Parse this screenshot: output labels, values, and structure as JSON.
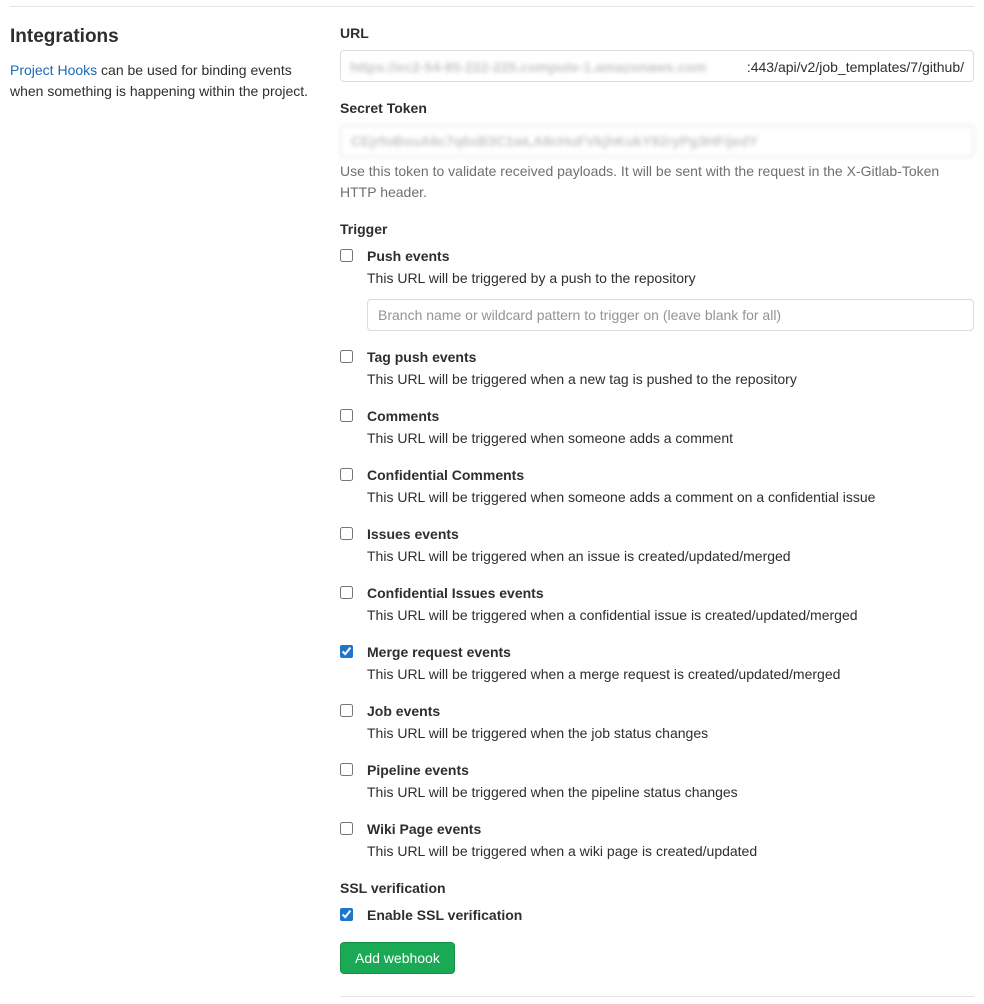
{
  "sidebar": {
    "heading": "Integrations",
    "link_text": "Project Hooks",
    "description_tail": " can be used for binding events when something is happening within the project."
  },
  "form": {
    "url_label": "URL",
    "url_blur_left": "https://ec2-54-85-222-225.compute-1.amazonaws.com",
    "url_clear_right": ":443/api/v2/job_templates/7/github/",
    "secret_label": "Secret Token",
    "secret_value": "CEjrfoBouA6c7q6xB3C1wLA8cHuFVkjhKukY92ryPg3HFijedY",
    "secret_help": "Use this token to validate received payloads. It will be sent with the request in the X-Gitlab-Token HTTP header.",
    "trigger_label": "Trigger",
    "branch_placeholder": "Branch name or wildcard pattern to trigger on (leave blank for all)",
    "ssl_label": "SSL verification",
    "submit_label": "Add webhook"
  },
  "triggers": [
    {
      "key": "push",
      "title": "Push events",
      "desc": "This URL will be triggered by a push to the repository",
      "checked": false,
      "has_branch": true
    },
    {
      "key": "tag-push",
      "title": "Tag push events",
      "desc": "This URL will be triggered when a new tag is pushed to the repository",
      "checked": false,
      "has_branch": false
    },
    {
      "key": "comments",
      "title": "Comments",
      "desc": "This URL will be triggered when someone adds a comment",
      "checked": false,
      "has_branch": false
    },
    {
      "key": "conf-comments",
      "title": "Confidential Comments",
      "desc": "This URL will be triggered when someone adds a comment on a confidential issue",
      "checked": false,
      "has_branch": false
    },
    {
      "key": "issues",
      "title": "Issues events",
      "desc": "This URL will be triggered when an issue is created/updated/merged",
      "checked": false,
      "has_branch": false
    },
    {
      "key": "conf-issues",
      "title": "Confidential Issues events",
      "desc": "This URL will be triggered when a confidential issue is created/updated/merged",
      "checked": false,
      "has_branch": false
    },
    {
      "key": "merge",
      "title": "Merge request events",
      "desc": "This URL will be triggered when a merge request is created/updated/merged",
      "checked": true,
      "has_branch": false
    },
    {
      "key": "job",
      "title": "Job events",
      "desc": "This URL will be triggered when the job status changes",
      "checked": false,
      "has_branch": false
    },
    {
      "key": "pipeline",
      "title": "Pipeline events",
      "desc": "This URL will be triggered when the pipeline status changes",
      "checked": false,
      "has_branch": false
    },
    {
      "key": "wiki",
      "title": "Wiki Page events",
      "desc": "This URL will be triggered when a wiki page is created/updated",
      "checked": false,
      "has_branch": false
    }
  ],
  "ssl": {
    "title": "Enable SSL verification",
    "checked": true
  }
}
